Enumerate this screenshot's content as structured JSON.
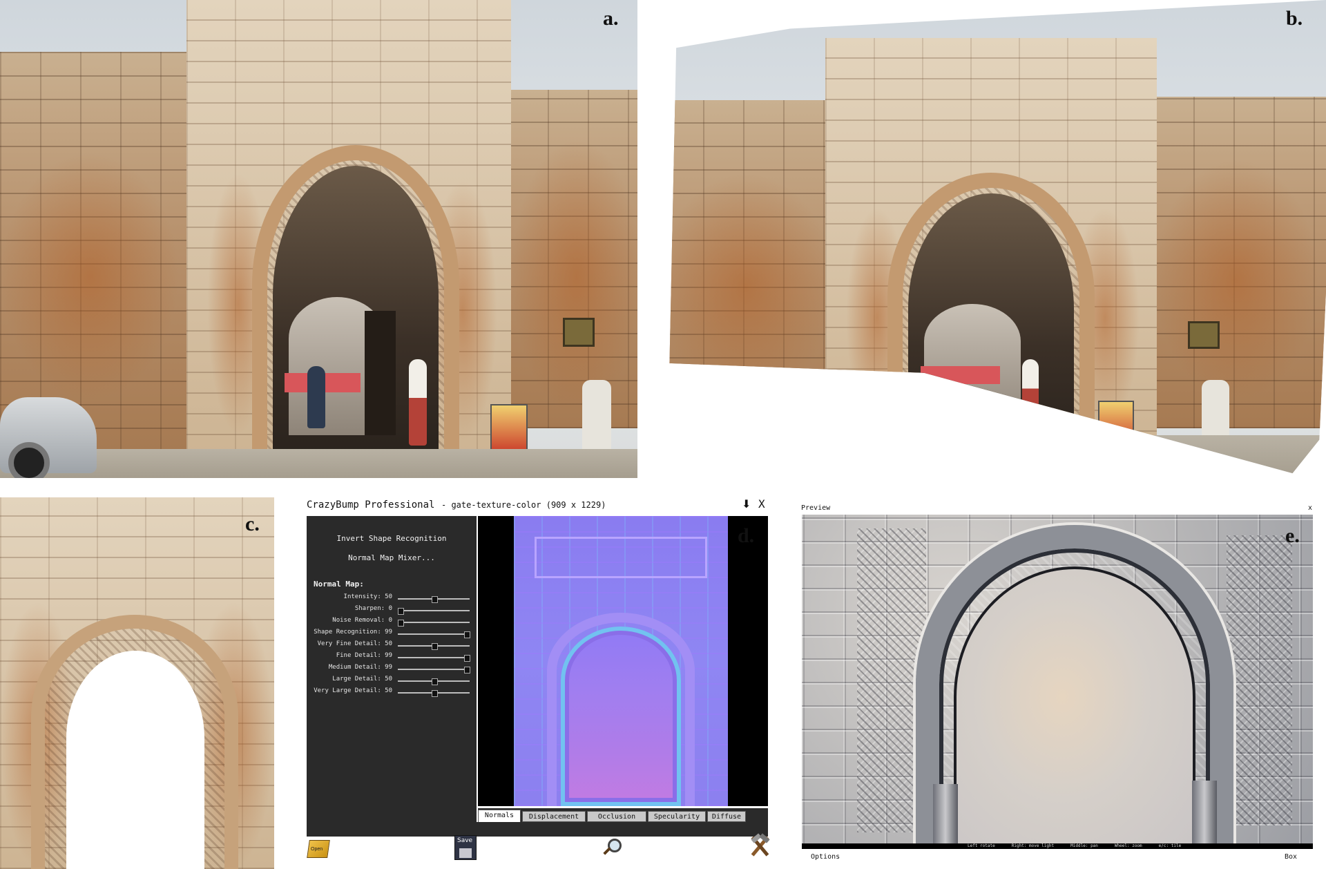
{
  "panels": {
    "a": "a.",
    "b": "b.",
    "c": "c.",
    "d": "d.",
    "e": "e."
  },
  "crazybump": {
    "app_name": "CrazyBump Professional",
    "file_info": "- gate-texture-color (909 x 1229)",
    "close_label": "X",
    "invert_label": "Invert Shape Recognition",
    "mixer_label": "Normal Map Mixer...",
    "section_heading": "Normal Map:",
    "sliders": [
      {
        "label": "Intensity: 50",
        "value": 50
      },
      {
        "label": "Sharpen: 0",
        "value": 0
      },
      {
        "label": "Noise Removal: 0",
        "value": 0
      },
      {
        "label": "Shape Recognition: 99",
        "value": 99
      },
      {
        "label": "Very Fine Detail: 50",
        "value": 50
      },
      {
        "label": "Fine Detail: 99",
        "value": 99
      },
      {
        "label": "Medium Detail: 99",
        "value": 99
      },
      {
        "label": "Large Detail: 50",
        "value": 50
      },
      {
        "label": "Very Large Detail: 50",
        "value": 50
      }
    ],
    "tabs": [
      "Normals",
      "Displacement",
      "Occlusion",
      "Specularity",
      "Diffuse"
    ],
    "active_tab": "Normals",
    "save_label": "Save",
    "open_label": "Open"
  },
  "preview": {
    "title": "Preview",
    "close_label": "x",
    "status_items": [
      "Left rotate",
      "Right: move light",
      "Middle: pan",
      "Wheel: zoom",
      "e/c: tile"
    ],
    "options_label": "Options",
    "box_label": "Box"
  }
}
